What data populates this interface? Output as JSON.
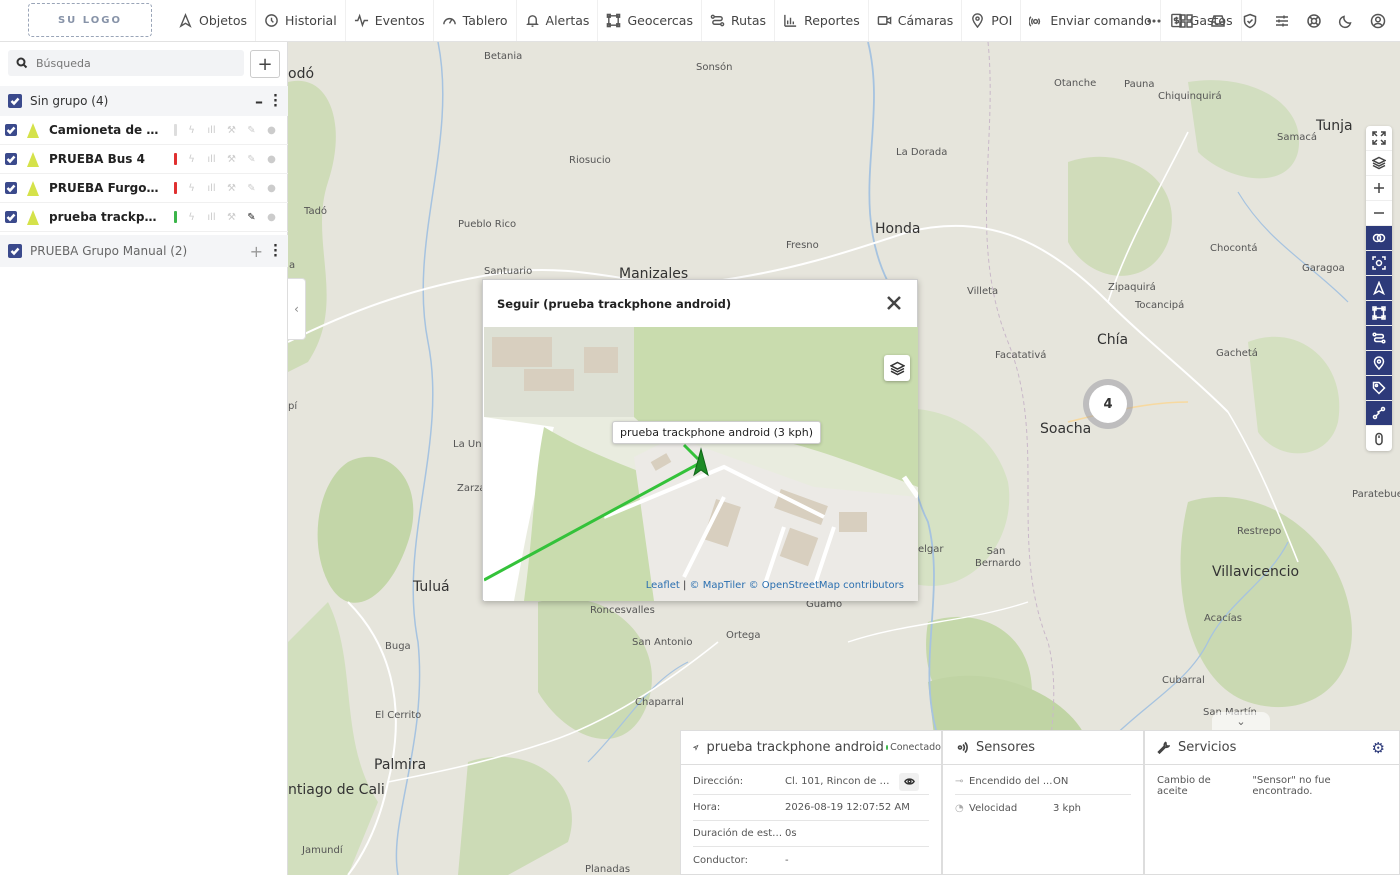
{
  "logo": {
    "text": "SU LOGO"
  },
  "nav": {
    "items": [
      {
        "label": "Objetos",
        "icon": "navigation-icon"
      },
      {
        "label": "Historial",
        "icon": "history-icon"
      },
      {
        "label": "Eventos",
        "icon": "activity-icon"
      },
      {
        "label": "Tablero",
        "icon": "gauge-icon"
      },
      {
        "label": "Alertas",
        "icon": "bell-icon"
      },
      {
        "label": "Geocercas",
        "icon": "geofence-icon"
      },
      {
        "label": "Rutas",
        "icon": "route-icon"
      },
      {
        "label": "Reportes",
        "icon": "bar-chart-icon"
      },
      {
        "label": "Cámaras",
        "icon": "video-icon"
      },
      {
        "label": "POI",
        "icon": "map-pin-icon"
      },
      {
        "label": "Enviar comando",
        "icon": "send-command-icon"
      },
      {
        "label": "Gastos",
        "icon": "expenses-icon"
      }
    ]
  },
  "sidebar": {
    "search_placeholder": "Búsqueda",
    "groups": [
      {
        "label": "Sin grupo (4)"
      },
      {
        "label": "PRUEBA Grupo Manual (2)"
      }
    ],
    "objects": [
      {
        "name": "Camioneta de rep...",
        "status_color": "#dddddd"
      },
      {
        "name": "PRUEBA Bus 4",
        "status_color": "#e03030"
      },
      {
        "name": "PRUEBA Furgon 3",
        "status_color": "#e03030"
      },
      {
        "name": "prueba trackphon...",
        "status_color": "#3bb54a"
      }
    ]
  },
  "map": {
    "cities": [
      {
        "name": "Betania"
      },
      {
        "name": "Sonsón"
      },
      {
        "name": "Otanche"
      },
      {
        "name": "Pauna"
      },
      {
        "name": "Chiquinquirá"
      },
      {
        "name": "Tunja"
      },
      {
        "name": "Samacá"
      },
      {
        "name": "Riosucio"
      },
      {
        "name": "La Dorada"
      },
      {
        "name": "Tadó"
      },
      {
        "name": "Pueblo Rico"
      },
      {
        "name": "Honda"
      },
      {
        "name": "Fresno"
      },
      {
        "name": "Chocontá"
      },
      {
        "name": "Garagoa"
      },
      {
        "name": "Santuario"
      },
      {
        "name": "Manizales"
      },
      {
        "name": "Villeta"
      },
      {
        "name": "Zipaquirá"
      },
      {
        "name": "Tocancipá"
      },
      {
        "name": "Chía"
      },
      {
        "name": "Facatativá"
      },
      {
        "name": "Gachetá"
      },
      {
        "name": "Soacha"
      },
      {
        "name": "La Unión"
      },
      {
        "name": "Zarza"
      },
      {
        "name": "Paratebue"
      },
      {
        "name": "Restrepo"
      },
      {
        "name": "elgar"
      },
      {
        "name": "San Bernardo"
      },
      {
        "name": "Villavicencio"
      },
      {
        "name": "Tuluá"
      },
      {
        "name": "Roncesvalles"
      },
      {
        "name": "Guamo"
      },
      {
        "name": "Acacías"
      },
      {
        "name": "San Antonio"
      },
      {
        "name": "Ortega"
      },
      {
        "name": "Buga"
      },
      {
        "name": "Chaparral"
      },
      {
        "name": "Cubarral"
      },
      {
        "name": "El Cerrito"
      },
      {
        "name": "Palmira"
      },
      {
        "name": "ntiago de Cali"
      },
      {
        "name": "Jamundí"
      },
      {
        "name": "Planadas"
      },
      {
        "name": "odó"
      },
      {
        "name": "pí"
      },
      {
        "name": "San Martín"
      },
      {
        "name": "a"
      }
    ],
    "cluster_count": "4"
  },
  "follow": {
    "title": "Seguir (prueba trackphone android)",
    "tooltip": "prueba trackphone android (3 kph)",
    "attribution_leaflet": "Leaflet",
    "attribution_sep": " | ",
    "attribution_rest": "© MapTiler © OpenStreetMap contributors"
  },
  "object_panel": {
    "title": "prueba trackphone android",
    "status": "Conectado",
    "rows": [
      {
        "key": "Dirección:",
        "value": "Cl. 101, Rincon de La P..."
      },
      {
        "key": "Hora:",
        "value": "2026-08-19 12:07:52 AM"
      },
      {
        "key": "Duración de esta...",
        "value": "0s"
      },
      {
        "key": "Conductor:",
        "value": "-"
      }
    ]
  },
  "sensors_panel": {
    "title": "Sensores",
    "rows": [
      {
        "key": "Encendido del ...",
        "value": "ON"
      },
      {
        "key": "Velocidad",
        "value": "3 kph"
      }
    ]
  },
  "services_panel": {
    "title": "Servicios",
    "row_key": "Cambio de aceite",
    "row_value": "\"Sensor\" no fue encontrado."
  }
}
